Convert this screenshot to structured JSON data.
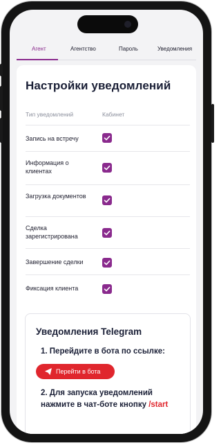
{
  "tabs": [
    {
      "label": "Агент",
      "active": true
    },
    {
      "label": "Агентство",
      "active": false
    },
    {
      "label": "Пароль",
      "active": false
    },
    {
      "label": "Уведомления",
      "active": false
    }
  ],
  "settings": {
    "title": "Настройки уведомлений",
    "col_type": "Тип уведомлений",
    "col_cabinet": "Кабинет",
    "rows": [
      {
        "label": "Запись на встречу",
        "checked": true
      },
      {
        "label": "Информация о клиентах",
        "checked": true
      },
      {
        "label": "Загрузка документов",
        "checked": true
      },
      {
        "label": "Сделка зарегистрирована",
        "checked": true
      },
      {
        "label": "Завершение сделки",
        "checked": true
      },
      {
        "label": "Фиксация клиента",
        "checked": true
      }
    ]
  },
  "telegram": {
    "title": "Уведомления Telegram",
    "step1": "1. Перейдите в бота по ссылке:",
    "button_label": "Перейти в бота",
    "step2": "2. Для запуска уведомлений нажмите в чат-боте кнопку",
    "command": "/start"
  },
  "colors": {
    "accent": "#8a2a8d",
    "telegram_red": "#e0262d",
    "text": "#1a1f36"
  }
}
